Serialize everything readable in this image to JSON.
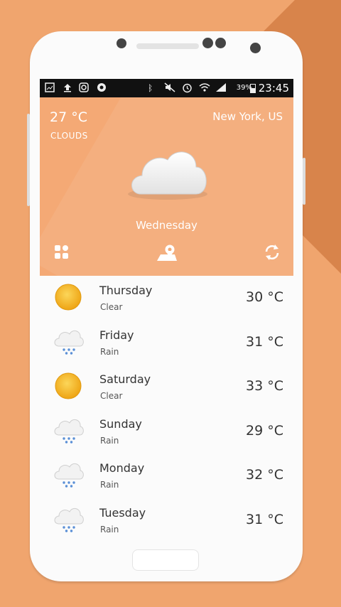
{
  "status_bar": {
    "battery": "39%",
    "time": "23:45",
    "icons": [
      "gallery-icon",
      "upload-icon",
      "instagram-icon",
      "chrome-icon",
      "bluetooth-icon",
      "mute-icon",
      "alarm-icon",
      "wifi-icon",
      "signal-icon",
      "battery-icon"
    ]
  },
  "current": {
    "temperature": "27 °C",
    "condition": "CLOUDS",
    "location": "New York, US",
    "day": "Wednesday",
    "icon": "cloud-icon"
  },
  "toolbar": {
    "left_icon": "grid-icon",
    "center_icon": "map-pin-icon",
    "right_icon": "refresh-icon"
  },
  "forecast": [
    {
      "day": "Thursday",
      "desc": "Clear",
      "temp": "30 °C",
      "icon": "sun-icon"
    },
    {
      "day": "Friday",
      "desc": "Rain",
      "temp": "31 °C",
      "icon": "rain-cloud-icon"
    },
    {
      "day": "Saturday",
      "desc": "Clear",
      "temp": "33 °C",
      "icon": "sun-icon"
    },
    {
      "day": "Sunday",
      "desc": "Rain",
      "temp": "29 °C",
      "icon": "rain-cloud-icon"
    },
    {
      "day": "Monday",
      "desc": "Rain",
      "temp": "32 °C",
      "icon": "rain-cloud-icon"
    },
    {
      "day": "Tuesday",
      "desc": "Rain",
      "temp": "31 °C",
      "icon": "rain-cloud-icon"
    }
  ],
  "colors": {
    "background": "#f0a56e",
    "header": "#f4a975",
    "sun": "#f6b92a"
  }
}
